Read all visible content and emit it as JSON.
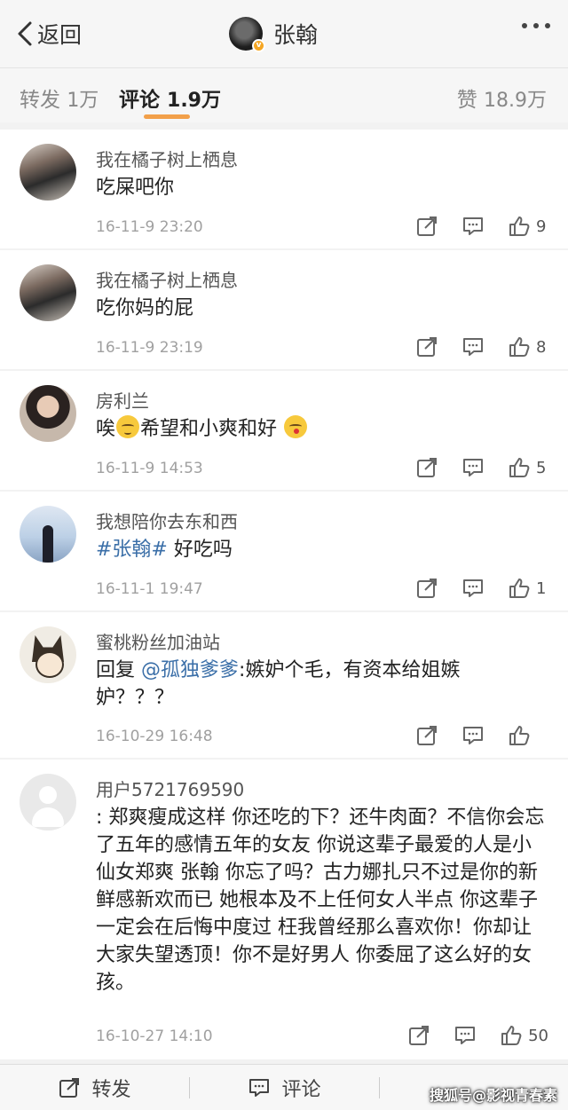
{
  "header": {
    "back_label": "返回",
    "title": "张翰"
  },
  "tabs": {
    "repost_label": "转发",
    "repost_count": "1万",
    "comment_label": "评论",
    "comment_count": "1.9万",
    "like_label": "赞",
    "like_count": "18.9万",
    "active": "comment",
    "accent_color": "#f2a04a"
  },
  "comments": [
    {
      "user": "我在橘子树上栖息",
      "text": "吃屎吧你",
      "time": "16-11-9 23:20",
      "likes": "9",
      "avatar": "girl-photo"
    },
    {
      "user": "我在橘子树上栖息",
      "text": "吃你妈的屁",
      "time": "16-11-9 23:19",
      "likes": "8",
      "avatar": "girl-photo"
    },
    {
      "user": "房利兰",
      "text_pre": "唉",
      "text_mid": "希望和小爽和好",
      "time": "16-11-9 14:53",
      "likes": "5",
      "avatar": "girl-portrait"
    },
    {
      "user": "我想陪你去东和西",
      "hashtag": "#张翰#",
      "text": " 好吃吗",
      "time": "16-11-1 19:47",
      "likes": "1",
      "avatar": "silhouette-sky"
    },
    {
      "user": "蜜桃粉丝加油站",
      "reply_prefix": "回复",
      "mention": "@孤独爹爹",
      "text": ":嫉妒个毛，有资本给姐嫉妒？？？",
      "time": "16-10-29 16:48",
      "likes": "",
      "avatar": "cartoon-cat"
    },
    {
      "user": "用户5721769590",
      "text": ": 郑爽瘦成这样 你还吃的下？还牛肉面？不信你会忘了五年的感情五年的女友 你说这辈子最爱的人是小仙女郑爽 张翰 你忘了吗？古力娜扎只不过是你的新鲜感新欢而已 她根本及不上任何女人半点 你这辈子一定会在后悔中度过 枉我曾经那么喜欢你！你却让大家失望透顶！你不是好男人 你委屈了这么好的女孩。",
      "time": "16-10-27 14:10",
      "likes": "50",
      "avatar": "default"
    }
  ],
  "bottom": {
    "repost_label": "转发",
    "comment_label": "评论"
  },
  "watermark": "搜狐号@影视青春素"
}
